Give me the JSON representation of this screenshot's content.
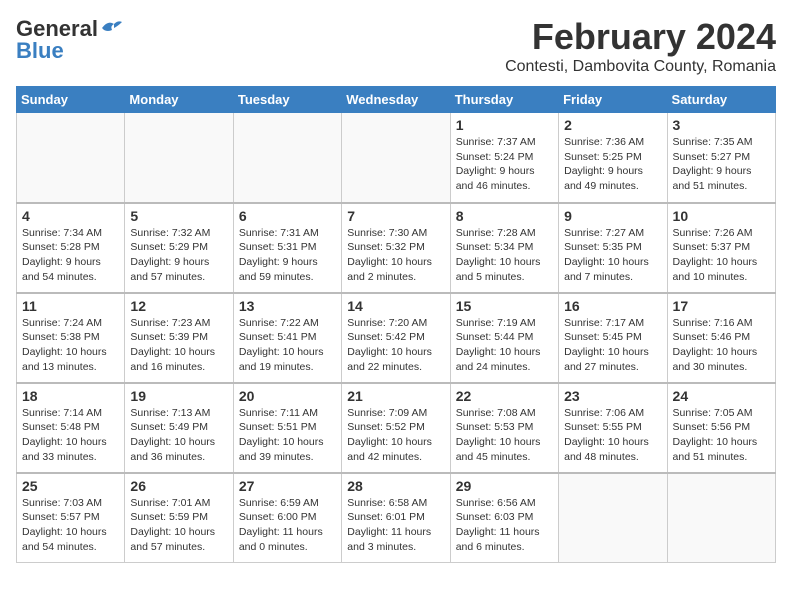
{
  "logo": {
    "general": "General",
    "blue": "Blue"
  },
  "title": {
    "month_year": "February 2024",
    "location": "Contesti, Dambovita County, Romania"
  },
  "headers": [
    "Sunday",
    "Monday",
    "Tuesday",
    "Wednesday",
    "Thursday",
    "Friday",
    "Saturday"
  ],
  "weeks": [
    [
      {
        "day": "",
        "info": ""
      },
      {
        "day": "",
        "info": ""
      },
      {
        "day": "",
        "info": ""
      },
      {
        "day": "",
        "info": ""
      },
      {
        "day": "1",
        "info": "Sunrise: 7:37 AM\nSunset: 5:24 PM\nDaylight: 9 hours\nand 46 minutes."
      },
      {
        "day": "2",
        "info": "Sunrise: 7:36 AM\nSunset: 5:25 PM\nDaylight: 9 hours\nand 49 minutes."
      },
      {
        "day": "3",
        "info": "Sunrise: 7:35 AM\nSunset: 5:27 PM\nDaylight: 9 hours\nand 51 minutes."
      }
    ],
    [
      {
        "day": "4",
        "info": "Sunrise: 7:34 AM\nSunset: 5:28 PM\nDaylight: 9 hours\nand 54 minutes."
      },
      {
        "day": "5",
        "info": "Sunrise: 7:32 AM\nSunset: 5:29 PM\nDaylight: 9 hours\nand 57 minutes."
      },
      {
        "day": "6",
        "info": "Sunrise: 7:31 AM\nSunset: 5:31 PM\nDaylight: 9 hours\nand 59 minutes."
      },
      {
        "day": "7",
        "info": "Sunrise: 7:30 AM\nSunset: 5:32 PM\nDaylight: 10 hours\nand 2 minutes."
      },
      {
        "day": "8",
        "info": "Sunrise: 7:28 AM\nSunset: 5:34 PM\nDaylight: 10 hours\nand 5 minutes."
      },
      {
        "day": "9",
        "info": "Sunrise: 7:27 AM\nSunset: 5:35 PM\nDaylight: 10 hours\nand 7 minutes."
      },
      {
        "day": "10",
        "info": "Sunrise: 7:26 AM\nSunset: 5:37 PM\nDaylight: 10 hours\nand 10 minutes."
      }
    ],
    [
      {
        "day": "11",
        "info": "Sunrise: 7:24 AM\nSunset: 5:38 PM\nDaylight: 10 hours\nand 13 minutes."
      },
      {
        "day": "12",
        "info": "Sunrise: 7:23 AM\nSunset: 5:39 PM\nDaylight: 10 hours\nand 16 minutes."
      },
      {
        "day": "13",
        "info": "Sunrise: 7:22 AM\nSunset: 5:41 PM\nDaylight: 10 hours\nand 19 minutes."
      },
      {
        "day": "14",
        "info": "Sunrise: 7:20 AM\nSunset: 5:42 PM\nDaylight: 10 hours\nand 22 minutes."
      },
      {
        "day": "15",
        "info": "Sunrise: 7:19 AM\nSunset: 5:44 PM\nDaylight: 10 hours\nand 24 minutes."
      },
      {
        "day": "16",
        "info": "Sunrise: 7:17 AM\nSunset: 5:45 PM\nDaylight: 10 hours\nand 27 minutes."
      },
      {
        "day": "17",
        "info": "Sunrise: 7:16 AM\nSunset: 5:46 PM\nDaylight: 10 hours\nand 30 minutes."
      }
    ],
    [
      {
        "day": "18",
        "info": "Sunrise: 7:14 AM\nSunset: 5:48 PM\nDaylight: 10 hours\nand 33 minutes."
      },
      {
        "day": "19",
        "info": "Sunrise: 7:13 AM\nSunset: 5:49 PM\nDaylight: 10 hours\nand 36 minutes."
      },
      {
        "day": "20",
        "info": "Sunrise: 7:11 AM\nSunset: 5:51 PM\nDaylight: 10 hours\nand 39 minutes."
      },
      {
        "day": "21",
        "info": "Sunrise: 7:09 AM\nSunset: 5:52 PM\nDaylight: 10 hours\nand 42 minutes."
      },
      {
        "day": "22",
        "info": "Sunrise: 7:08 AM\nSunset: 5:53 PM\nDaylight: 10 hours\nand 45 minutes."
      },
      {
        "day": "23",
        "info": "Sunrise: 7:06 AM\nSunset: 5:55 PM\nDaylight: 10 hours\nand 48 minutes."
      },
      {
        "day": "24",
        "info": "Sunrise: 7:05 AM\nSunset: 5:56 PM\nDaylight: 10 hours\nand 51 minutes."
      }
    ],
    [
      {
        "day": "25",
        "info": "Sunrise: 7:03 AM\nSunset: 5:57 PM\nDaylight: 10 hours\nand 54 minutes."
      },
      {
        "day": "26",
        "info": "Sunrise: 7:01 AM\nSunset: 5:59 PM\nDaylight: 10 hours\nand 57 minutes."
      },
      {
        "day": "27",
        "info": "Sunrise: 6:59 AM\nSunset: 6:00 PM\nDaylight: 11 hours\nand 0 minutes."
      },
      {
        "day": "28",
        "info": "Sunrise: 6:58 AM\nSunset: 6:01 PM\nDaylight: 11 hours\nand 3 minutes."
      },
      {
        "day": "29",
        "info": "Sunrise: 6:56 AM\nSunset: 6:03 PM\nDaylight: 11 hours\nand 6 minutes."
      },
      {
        "day": "",
        "info": ""
      },
      {
        "day": "",
        "info": ""
      }
    ]
  ]
}
